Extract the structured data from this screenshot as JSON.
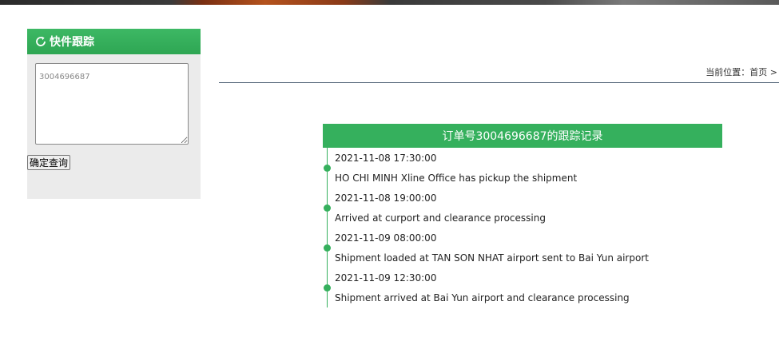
{
  "sidebar": {
    "title": "快件跟踪",
    "icon": "refresh-icon",
    "textarea_value": "3004696687",
    "button_label": "确定查询"
  },
  "breadcrumb": {
    "label": "当前位置：",
    "home": "首页",
    "separator": ">"
  },
  "record": {
    "title": "订单号3004696687的跟踪记录",
    "events": [
      {
        "time": "2021-11-08 17:30:00",
        "desc": "HO CHI MINH Xline Office has pickup the shipment"
      },
      {
        "time": "2021-11-08 19:00:00",
        "desc": "Arrived at curport and clearance processing"
      },
      {
        "time": "2021-11-09 08:00:00",
        "desc": "Shipment loaded at TAN SON NHAT airport sent to Bai Yun airport"
      },
      {
        "time": "2021-11-09 12:30:00",
        "desc": "Shipment arrived at Bai Yun airport and clearance processing"
      }
    ]
  },
  "colors": {
    "accent_green": "#35b05d",
    "divider": "#4b5e72"
  }
}
